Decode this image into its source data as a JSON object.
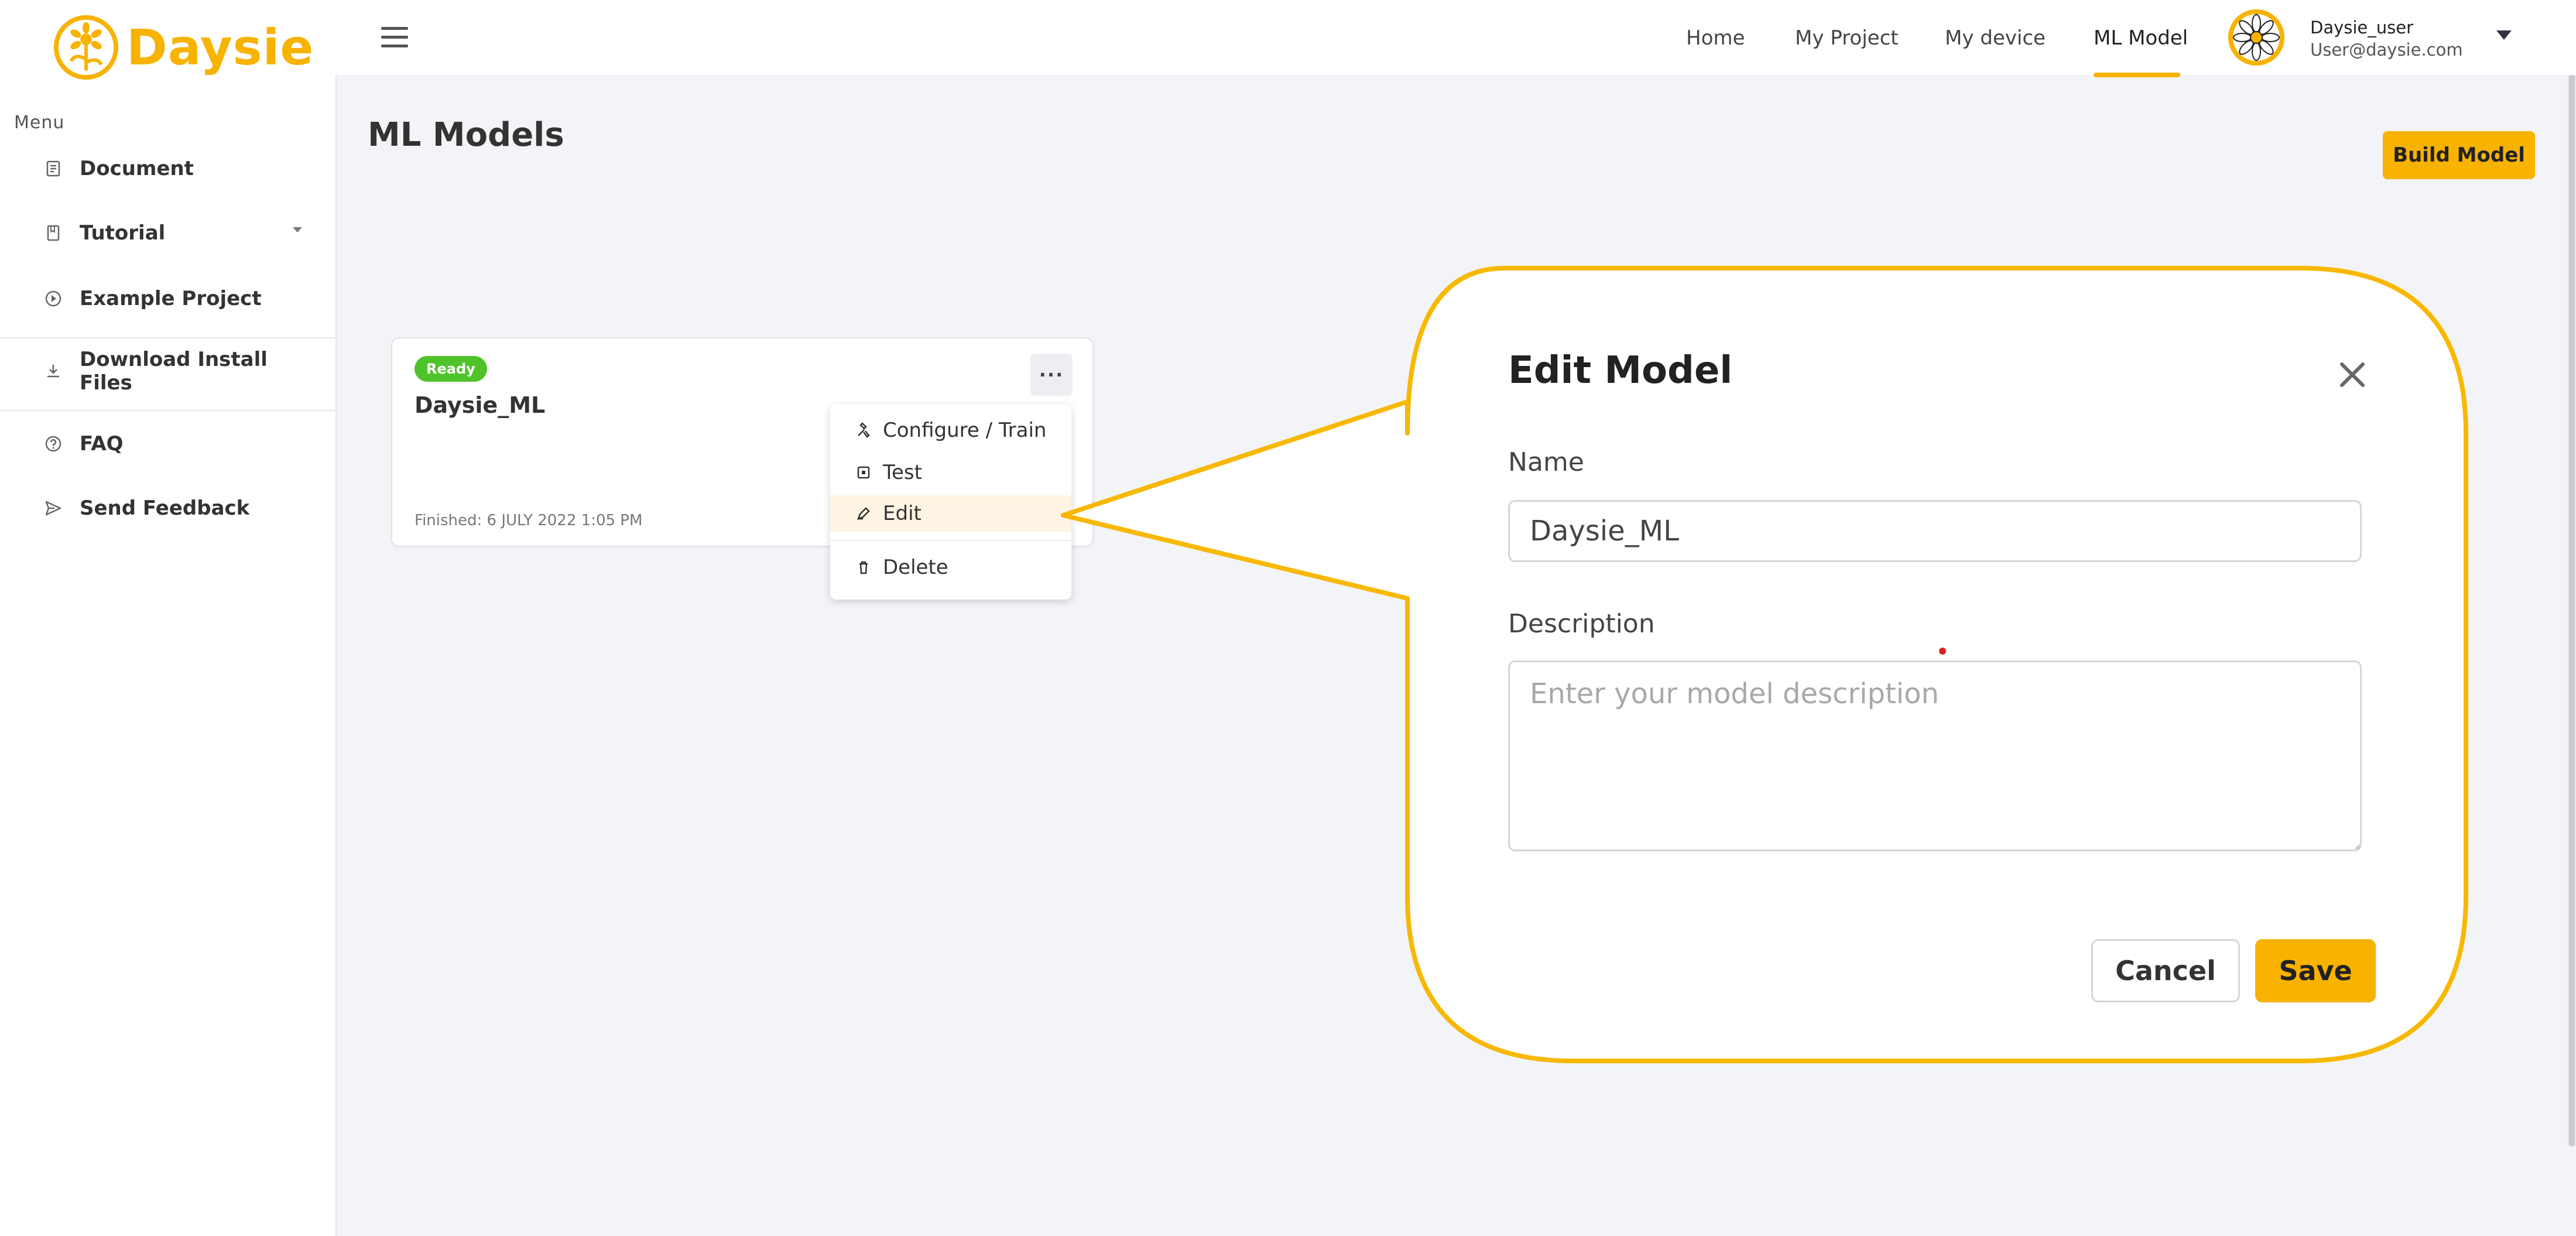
{
  "brand": {
    "name": "Daysie",
    "color": "#f8b200"
  },
  "sidebar": {
    "menu_label": "Menu",
    "items": [
      {
        "label": "Document",
        "icon": "document-icon"
      },
      {
        "label": "Tutorial",
        "icon": "book-icon",
        "has_submenu": true
      },
      {
        "label": "Example Project",
        "icon": "play-circle-icon"
      },
      {
        "label": "Download Install Files",
        "icon": "download-icon"
      },
      {
        "label": "FAQ",
        "icon": "question-circle-icon"
      },
      {
        "label": "Send Feedback",
        "icon": "send-icon"
      }
    ]
  },
  "topbar": {
    "nav": [
      {
        "label": "Home"
      },
      {
        "label": "My Project"
      },
      {
        "label": "My device"
      },
      {
        "label": "ML Model",
        "active": true
      }
    ],
    "user": {
      "name": "Daysie_user",
      "email": "User@daysie.com"
    }
  },
  "main": {
    "title": "ML Models",
    "build_button": "Build Model",
    "card": {
      "status": "Ready",
      "status_color": "#4fc42a",
      "name": "Daysie_ML",
      "finished": "Finished: 6 JULY 2022 1:05 PM",
      "more_label": "···"
    },
    "menu": [
      {
        "label": "Configure / Train",
        "icon": "tools-icon"
      },
      {
        "label": "Test",
        "icon": "test-box-icon"
      },
      {
        "label": "Edit",
        "icon": "pencil-icon",
        "active": true
      },
      {
        "label": "Delete",
        "icon": "trash-icon"
      }
    ]
  },
  "modal": {
    "title": "Edit Model",
    "name_label": "Name",
    "name_value": "Daysie_ML",
    "description_label": "Description",
    "description_placeholder": "Enter your model description",
    "cancel": "Cancel",
    "save": "Save",
    "callout_color": "#f8b800"
  }
}
